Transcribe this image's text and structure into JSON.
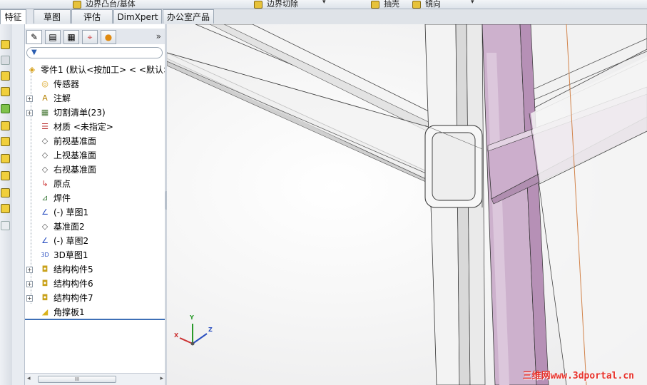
{
  "toolbar_top": {
    "item1": "边界凸台/基体",
    "item2": "边界切除",
    "item3": "抽壳",
    "item4": "镜向"
  },
  "command_tabs": [
    "特征",
    "草图",
    "评估",
    "DimXpert",
    "办公室产品"
  ],
  "active_tab": "特征",
  "feature_manager": {
    "filter_icon": "funnel-icon",
    "collapse_symbol": "»",
    "root": "零件1 (默认<按加工> < <默认>",
    "items": [
      {
        "label": "传感器",
        "icon": "sensor-icon",
        "expandable": false
      },
      {
        "label": "注解",
        "icon": "annotation-icon",
        "expandable": true
      },
      {
        "label": "切割清单(23)",
        "icon": "cutlist-icon",
        "expandable": true
      },
      {
        "label": "材质 <未指定>",
        "icon": "material-icon",
        "expandable": false
      },
      {
        "label": "前视基准面",
        "icon": "plane-icon",
        "expandable": false
      },
      {
        "label": "上视基准面",
        "icon": "plane-icon",
        "expandable": false
      },
      {
        "label": "右视基准面",
        "icon": "plane-icon",
        "expandable": false
      },
      {
        "label": "原点",
        "icon": "origin-icon",
        "expandable": false
      },
      {
        "label": "焊件",
        "icon": "weldment-icon",
        "expandable": false
      },
      {
        "label": "(-) 草图1",
        "icon": "sketch-icon",
        "expandable": false
      },
      {
        "label": "基准面2",
        "icon": "plane-icon",
        "expandable": false
      },
      {
        "label": "(-) 草图2",
        "icon": "sketch-icon",
        "expandable": false
      },
      {
        "label": "3D草图1",
        "icon": "3dsketch-icon",
        "expandable": false
      },
      {
        "label": "结构构件5",
        "icon": "structural-member-icon",
        "expandable": true
      },
      {
        "label": "结构构件6",
        "icon": "structural-member-icon",
        "expandable": true
      },
      {
        "label": "结构构件7",
        "icon": "structural-member-icon",
        "expandable": true
      },
      {
        "label": "角撑板1",
        "icon": "gusset-icon",
        "expandable": false
      }
    ],
    "scroll_thumb_text": "III"
  },
  "triad": {
    "x": "X",
    "y": "Y",
    "z": "Z"
  },
  "watermark": "三维网www.3dportal.cn",
  "colors": {
    "accent": "#3d6fb6",
    "purple_beam": "#c9a9c9",
    "watermark": "#e8332c"
  }
}
